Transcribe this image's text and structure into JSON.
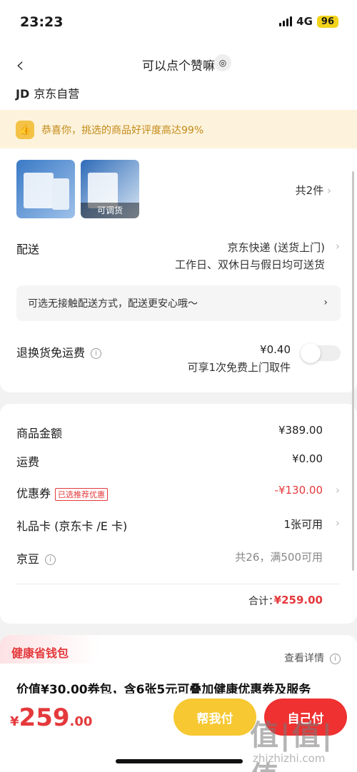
{
  "status": {
    "time": "23:23",
    "network": "4G",
    "battery": "96"
  },
  "nav": {
    "title": "可以点个赞嘛",
    "shop_brand": "JD",
    "shop_name": "京东自营"
  },
  "banner": {
    "text": "恭喜你，挑选的商品好评度高达99%"
  },
  "items": {
    "count_text": "共2件",
    "thumb2_tag": "可调货"
  },
  "shipping": {
    "label": "配送",
    "method": "京东快递 (送货上门)",
    "schedule": "工作日、双休日与假日均可送货",
    "contactless": "可选无接触配送方式，配送更安心哦～"
  },
  "returns": {
    "label": "退换货免运费",
    "price": "¥0.40",
    "sub": "可享1次免费上门取件"
  },
  "fees": [
    {
      "label": "商品金额",
      "value": "¥389.00"
    },
    {
      "label": "运费",
      "value": "¥0.00"
    },
    {
      "label": "优惠券",
      "tag": "已选推荐优惠",
      "value": "-¥130.00"
    },
    {
      "label": "礼品卡 (京东卡 /E 卡)",
      "value": "1张可用"
    },
    {
      "label": "京豆",
      "value": "共26，满500可用"
    }
  ],
  "total": {
    "label": "合计：",
    "value": "¥259.00"
  },
  "health": {
    "title": "健康省钱包",
    "details": "查看详情",
    "package": "价值¥30.00券包，含6张5元可叠加健康优惠券及服务"
  },
  "bottom": {
    "currency": "¥",
    "price_int": "259",
    "price_dec": ".00",
    "help_pay": "帮我付",
    "self_pay": "自己付"
  },
  "watermark": {
    "main": "值|值|值",
    "sub": "zhizhizhi.com"
  },
  "colors": {
    "accent_red": "#e4393c",
    "yellow_btn": "#f7c832",
    "red_btn": "#ef3131",
    "banner_bg": "#fdf3dc"
  }
}
